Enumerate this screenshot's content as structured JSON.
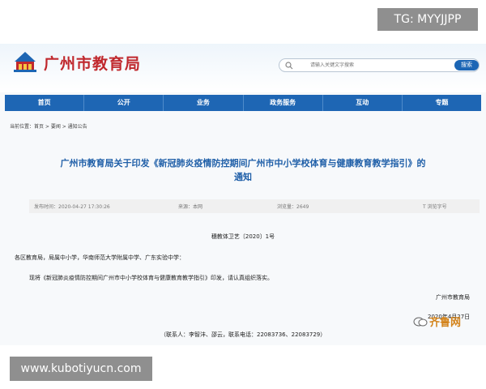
{
  "watermarks": {
    "top": "TG: MYYJJPP",
    "bottom": "www.kubotiyucn.com",
    "corner": "齐鲁网"
  },
  "header": {
    "site_title": "广州市教育局"
  },
  "search": {
    "placeholder": "请输入关键文字搜索",
    "button": "搜索"
  },
  "nav": [
    {
      "label": "首页"
    },
    {
      "label": "公开"
    },
    {
      "label": "业务"
    },
    {
      "label": "政务服务"
    },
    {
      "label": "互动"
    },
    {
      "label": "专题"
    }
  ],
  "breadcrumb": "当前位置：首页 > 要闻 > 通知公告",
  "article": {
    "title_line1": "广州市教育局关于印发《新冠肺炎疫情防控期间广州市中小学校体育与健康教育教学指引》的",
    "title_line2": "通知",
    "meta": {
      "date": "发布时间：2020-04-27 17:30:26",
      "source": "来源：本网",
      "views": "浏览量：2649",
      "font": "T  浏览字号"
    },
    "doc_number": "穗教体卫艺〔2020〕1号",
    "greeting": "各区教育局，局属中小学，华南师范大学附属中学、广东实验中学：",
    "body": "现将《新冠肺炎疫情防控期间广州市中小学校体育与健康教育教学指引》印发，请认真组织落实。",
    "signature_org": "广州市教育局",
    "signature_date": "2020年4月27日",
    "contact": "（联系人：李智沣、邵云，联系电话：22083736、22083729）"
  },
  "colors": {
    "nav_bg": "#1e66b4",
    "title_red": "#c0282d",
    "article_blue": "#1f5fa8",
    "corner_orange": "#d3831a"
  }
}
